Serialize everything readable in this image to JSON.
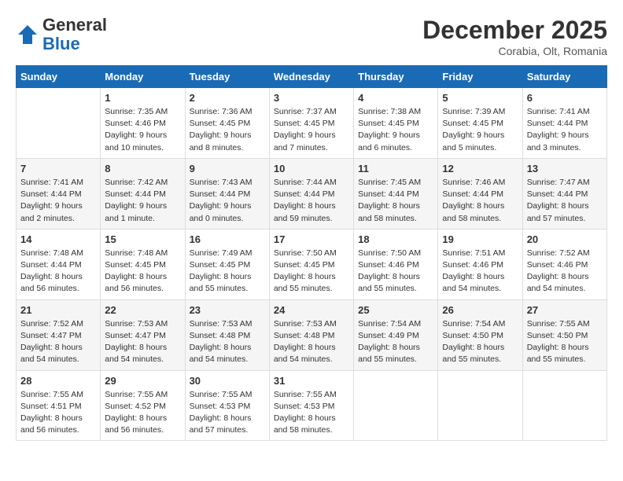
{
  "header": {
    "logo_line1": "General",
    "logo_line2": "Blue",
    "month": "December 2025",
    "location": "Corabia, Olt, Romania"
  },
  "days_of_week": [
    "Sunday",
    "Monday",
    "Tuesday",
    "Wednesday",
    "Thursday",
    "Friday",
    "Saturday"
  ],
  "weeks": [
    [
      {
        "day": "",
        "info": ""
      },
      {
        "day": "1",
        "info": "Sunrise: 7:35 AM\nSunset: 4:46 PM\nDaylight: 9 hours\nand 10 minutes."
      },
      {
        "day": "2",
        "info": "Sunrise: 7:36 AM\nSunset: 4:45 PM\nDaylight: 9 hours\nand 8 minutes."
      },
      {
        "day": "3",
        "info": "Sunrise: 7:37 AM\nSunset: 4:45 PM\nDaylight: 9 hours\nand 7 minutes."
      },
      {
        "day": "4",
        "info": "Sunrise: 7:38 AM\nSunset: 4:45 PM\nDaylight: 9 hours\nand 6 minutes."
      },
      {
        "day": "5",
        "info": "Sunrise: 7:39 AM\nSunset: 4:45 PM\nDaylight: 9 hours\nand 5 minutes."
      },
      {
        "day": "6",
        "info": "Sunrise: 7:41 AM\nSunset: 4:44 PM\nDaylight: 9 hours\nand 3 minutes."
      }
    ],
    [
      {
        "day": "7",
        "info": "Sunrise: 7:41 AM\nSunset: 4:44 PM\nDaylight: 9 hours\nand 2 minutes."
      },
      {
        "day": "8",
        "info": "Sunrise: 7:42 AM\nSunset: 4:44 PM\nDaylight: 9 hours\nand 1 minute."
      },
      {
        "day": "9",
        "info": "Sunrise: 7:43 AM\nSunset: 4:44 PM\nDaylight: 9 hours\nand 0 minutes."
      },
      {
        "day": "10",
        "info": "Sunrise: 7:44 AM\nSunset: 4:44 PM\nDaylight: 8 hours\nand 59 minutes."
      },
      {
        "day": "11",
        "info": "Sunrise: 7:45 AM\nSunset: 4:44 PM\nDaylight: 8 hours\nand 58 minutes."
      },
      {
        "day": "12",
        "info": "Sunrise: 7:46 AM\nSunset: 4:44 PM\nDaylight: 8 hours\nand 58 minutes."
      },
      {
        "day": "13",
        "info": "Sunrise: 7:47 AM\nSunset: 4:44 PM\nDaylight: 8 hours\nand 57 minutes."
      }
    ],
    [
      {
        "day": "14",
        "info": "Sunrise: 7:48 AM\nSunset: 4:44 PM\nDaylight: 8 hours\nand 56 minutes."
      },
      {
        "day": "15",
        "info": "Sunrise: 7:48 AM\nSunset: 4:45 PM\nDaylight: 8 hours\nand 56 minutes."
      },
      {
        "day": "16",
        "info": "Sunrise: 7:49 AM\nSunset: 4:45 PM\nDaylight: 8 hours\nand 55 minutes."
      },
      {
        "day": "17",
        "info": "Sunrise: 7:50 AM\nSunset: 4:45 PM\nDaylight: 8 hours\nand 55 minutes."
      },
      {
        "day": "18",
        "info": "Sunrise: 7:50 AM\nSunset: 4:46 PM\nDaylight: 8 hours\nand 55 minutes."
      },
      {
        "day": "19",
        "info": "Sunrise: 7:51 AM\nSunset: 4:46 PM\nDaylight: 8 hours\nand 54 minutes."
      },
      {
        "day": "20",
        "info": "Sunrise: 7:52 AM\nSunset: 4:46 PM\nDaylight: 8 hours\nand 54 minutes."
      }
    ],
    [
      {
        "day": "21",
        "info": "Sunrise: 7:52 AM\nSunset: 4:47 PM\nDaylight: 8 hours\nand 54 minutes."
      },
      {
        "day": "22",
        "info": "Sunrise: 7:53 AM\nSunset: 4:47 PM\nDaylight: 8 hours\nand 54 minutes."
      },
      {
        "day": "23",
        "info": "Sunrise: 7:53 AM\nSunset: 4:48 PM\nDaylight: 8 hours\nand 54 minutes."
      },
      {
        "day": "24",
        "info": "Sunrise: 7:53 AM\nSunset: 4:48 PM\nDaylight: 8 hours\nand 54 minutes."
      },
      {
        "day": "25",
        "info": "Sunrise: 7:54 AM\nSunset: 4:49 PM\nDaylight: 8 hours\nand 55 minutes."
      },
      {
        "day": "26",
        "info": "Sunrise: 7:54 AM\nSunset: 4:50 PM\nDaylight: 8 hours\nand 55 minutes."
      },
      {
        "day": "27",
        "info": "Sunrise: 7:55 AM\nSunset: 4:50 PM\nDaylight: 8 hours\nand 55 minutes."
      }
    ],
    [
      {
        "day": "28",
        "info": "Sunrise: 7:55 AM\nSunset: 4:51 PM\nDaylight: 8 hours\nand 56 minutes."
      },
      {
        "day": "29",
        "info": "Sunrise: 7:55 AM\nSunset: 4:52 PM\nDaylight: 8 hours\nand 56 minutes."
      },
      {
        "day": "30",
        "info": "Sunrise: 7:55 AM\nSunset: 4:53 PM\nDaylight: 8 hours\nand 57 minutes."
      },
      {
        "day": "31",
        "info": "Sunrise: 7:55 AM\nSunset: 4:53 PM\nDaylight: 8 hours\nand 58 minutes."
      },
      {
        "day": "",
        "info": ""
      },
      {
        "day": "",
        "info": ""
      },
      {
        "day": "",
        "info": ""
      }
    ]
  ]
}
